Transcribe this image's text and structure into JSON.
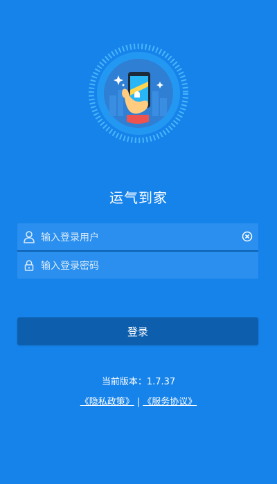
{
  "app": {
    "title": "运气到家"
  },
  "login": {
    "username_placeholder": "输入登录用户",
    "password_placeholder": "输入登录密码",
    "submit_label": "登录"
  },
  "footer": {
    "version_text": "当前版本：1.7.37",
    "privacy_link": "《隐私政策》",
    "separator": "|",
    "service_link": "《服务协议》"
  },
  "icons": {
    "logo": "phone-in-hand-logo",
    "username": "user-icon",
    "password": "lock-icon",
    "clear": "clear-icon"
  },
  "colors": {
    "background": "#1683eb",
    "input_bg": "#2a8fee",
    "button_bg": "#0d5fae"
  }
}
